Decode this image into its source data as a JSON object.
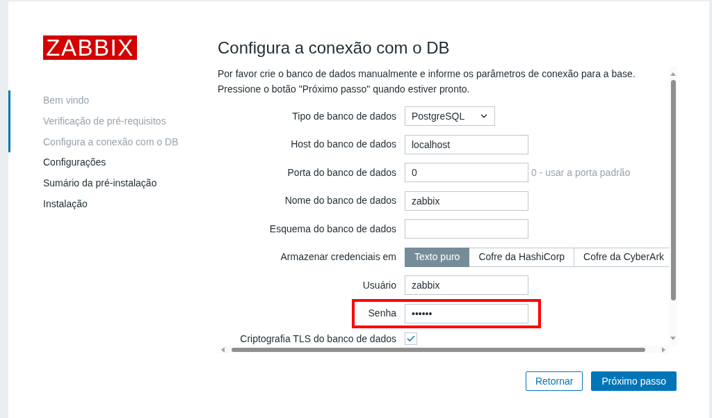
{
  "logo": {
    "text": "ZABBIX"
  },
  "steps": [
    {
      "label": "Bem vindo",
      "done": true
    },
    {
      "label": "Verificação de pré-requisitos",
      "done": true
    },
    {
      "label": "Configura a conexão com o DB",
      "done": true
    },
    {
      "label": "Configurações",
      "done": false
    },
    {
      "label": "Sumário da pré-instalação",
      "done": false
    },
    {
      "label": "Instalação",
      "done": false
    }
  ],
  "page": {
    "title": "Configura a conexão com o DB",
    "description": [
      "Por favor crie o banco de dados manualmente e informe os parâmetros de conexão para a base.",
      "Pressione o botão \"Próximo passo\" quando estiver pronto."
    ]
  },
  "form": {
    "fields": [
      {
        "kind": "select",
        "label": "Tipo de banco de dados",
        "value": "PostgreSQL",
        "highlighted": false
      },
      {
        "kind": "input",
        "label": "Host do banco de dados",
        "value": "localhost",
        "highlighted": false
      },
      {
        "kind": "input",
        "label": "Porta do banco de dados",
        "value": "0",
        "hint": "0 - usar a porta padrão",
        "highlighted": false
      },
      {
        "kind": "input",
        "label": "Nome do banco de dados",
        "value": "zabbix",
        "highlighted": false
      },
      {
        "kind": "input",
        "label": "Esquema do banco de dados",
        "highlighted": false
      },
      {
        "kind": "segmented",
        "label": "Armazenar credenciais em",
        "highlighted": false,
        "options": [
          {
            "label": "Texto puro",
            "selected": true
          },
          {
            "label": "Cofre da HashiCorp",
            "selected": false
          },
          {
            "label": "Cofre da CyberArk",
            "selected": false
          }
        ]
      },
      {
        "kind": "input",
        "label": "Usuário",
        "value": "zabbix",
        "highlighted": false
      },
      {
        "kind": "input",
        "label": "Senha",
        "value": "••••••",
        "highlighted": true
      },
      {
        "kind": "checkbox",
        "label": "Criptografia TLS do banco de dados",
        "checked": true,
        "highlighted": false
      }
    ]
  },
  "buttons": [
    {
      "label": "Retornar",
      "kind": "secondary"
    },
    {
      "label": "Próximo passo",
      "kind": "primary"
    }
  ]
}
